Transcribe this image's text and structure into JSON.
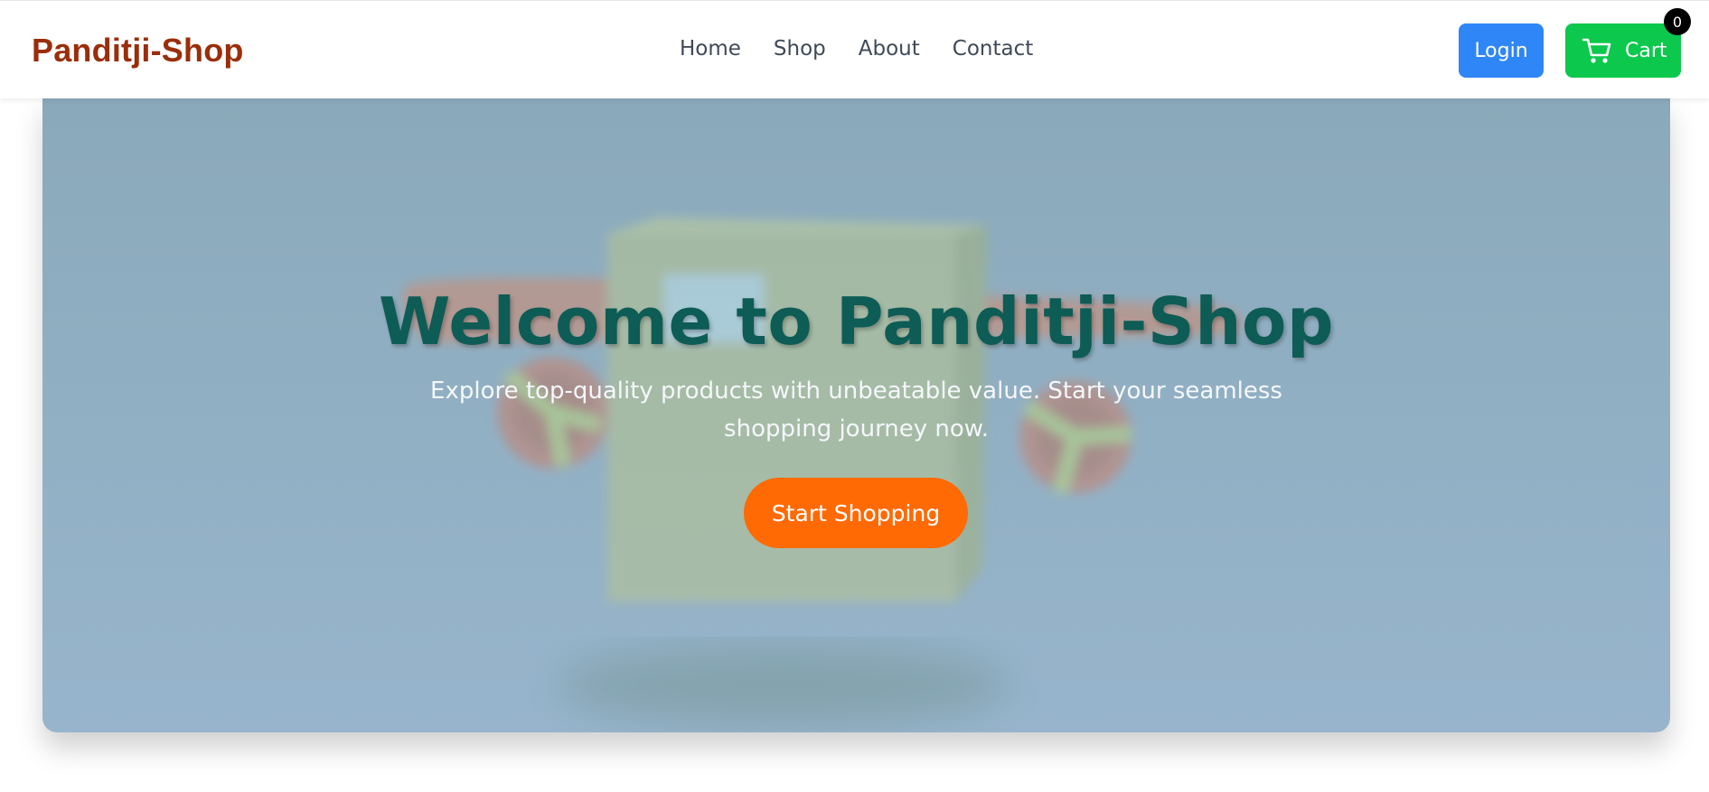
{
  "navbar": {
    "brand": "Panditji-Shop",
    "links": [
      "Home",
      "Shop",
      "About",
      "Contact"
    ],
    "login_label": "Login",
    "cart_label": "Cart",
    "cart_count": "0",
    "cart_icon": "cart-icon"
  },
  "hero": {
    "title": "Welcome to Panditji-Shop",
    "subtitle": "Explore top-quality products with unbeatable value. Start your seamless shopping journey now.",
    "cta_label": "Start Shopping",
    "image_subject": "delivery-drone-box-illustration"
  },
  "colors": {
    "brand": "#9a2e0b",
    "login": "#2f86f6",
    "cart": "#0cc84d",
    "cta": "#ff6a05",
    "title": "#0d5c55"
  }
}
